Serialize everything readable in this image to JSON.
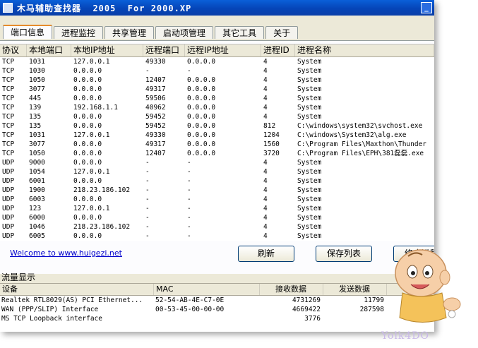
{
  "window": {
    "title": "木马辅助查找器  2005  For 2000.XP"
  },
  "tabs": [
    {
      "label": "端口信息"
    },
    {
      "label": "进程监控"
    },
    {
      "label": "共享管理"
    },
    {
      "label": "启动项管理"
    },
    {
      "label": "其它工具"
    },
    {
      "label": "关于"
    }
  ],
  "ports": {
    "columns": [
      "协议",
      "本地端口",
      "本地IP地址",
      "远程端口",
      "远程IP地址",
      "进程ID",
      "进程名称"
    ],
    "rows": [
      [
        "TCP",
        "1031",
        "127.0.0.1",
        "49330",
        "0.0.0.0",
        "4",
        "System"
      ],
      [
        "TCP",
        "1030",
        "0.0.0.0",
        "-",
        "-",
        "4",
        "System"
      ],
      [
        "TCP",
        "1050",
        "0.0.0.0",
        "12407",
        "0.0.0.0",
        "4",
        "System"
      ],
      [
        "TCP",
        "3077",
        "0.0.0.0",
        "49317",
        "0.0.0.0",
        "4",
        "System"
      ],
      [
        "TCP",
        "445",
        "0.0.0.0",
        "59506",
        "0.0.0.0",
        "4",
        "System"
      ],
      [
        "TCP",
        "139",
        "192.168.1.1",
        "40962",
        "0.0.0.0",
        "4",
        "System"
      ],
      [
        "TCP",
        "135",
        "0.0.0.0",
        "59452",
        "0.0.0.0",
        "4",
        "System"
      ],
      [
        "TCP",
        "135",
        "0.0.0.0",
        "59452",
        "0.0.0.0",
        "812",
        "C:\\windows\\system32\\svchost.exe"
      ],
      [
        "TCP",
        "1031",
        "127.0.0.1",
        "49330",
        "0.0.0.0",
        "1204",
        "C:\\windows\\System32\\alg.exe"
      ],
      [
        "TCP",
        "3077",
        "0.0.0.0",
        "49317",
        "0.0.0.0",
        "1560",
        "C:\\Program Files\\Maxthon\\Thunder"
      ],
      [
        "TCP",
        "1050",
        "0.0.0.0",
        "12407",
        "0.0.0.0",
        "3720",
        "C:\\Program Files\\EPH\\381磊磊.exe"
      ],
      [
        "UDP",
        "9000",
        "0.0.0.0",
        "-",
        "-",
        "4",
        "System"
      ],
      [
        "UDP",
        "1054",
        "127.0.0.1",
        "-",
        "-",
        "4",
        "System"
      ],
      [
        "UDP",
        "6001",
        "0.0.0.0",
        "-",
        "-",
        "4",
        "System"
      ],
      [
        "UDP",
        "1900",
        "218.23.186.102",
        "-",
        "-",
        "4",
        "System"
      ],
      [
        "UDP",
        "6003",
        "0.0.0.0",
        "-",
        "-",
        "4",
        "System"
      ],
      [
        "UDP",
        "123",
        "127.0.0.1",
        "-",
        "-",
        "4",
        "System"
      ],
      [
        "UDP",
        "6000",
        "0.0.0.0",
        "-",
        "-",
        "4",
        "System"
      ],
      [
        "UDP",
        "1046",
        "218.23.186.102",
        "-",
        "-",
        "4",
        "System"
      ],
      [
        "UDP",
        "6005",
        "0.0.0.0",
        "-",
        "-",
        "4",
        "System"
      ]
    ]
  },
  "footer": {
    "link": "Welcome to www.huigezi.net",
    "refresh_label": "刷新",
    "save_label": "保存列表",
    "stop_label": "终止进程"
  },
  "traffic": {
    "title": "流量显示",
    "columns": [
      "设备",
      "MAC",
      "接收数据",
      "发送数据"
    ],
    "rows": [
      [
        "Realtek RTL8029(AS) PCI Ethernet...",
        "52-54-AB-4E-C7-0E",
        "4731269",
        "11799"
      ],
      [
        "WAN (PPP/SLIP) Interface",
        "00-53-45-00-00-00",
        "4669422",
        "287598"
      ],
      [
        "MS TCP Loopback interface",
        "",
        "3776",
        ""
      ]
    ]
  },
  "watermark": "Yolk4DO",
  "icons": {
    "minimize": "minimize-icon",
    "maximize": "maximize-icon",
    "close": "close-icon",
    "mascot": "baby-mascot-icon"
  }
}
